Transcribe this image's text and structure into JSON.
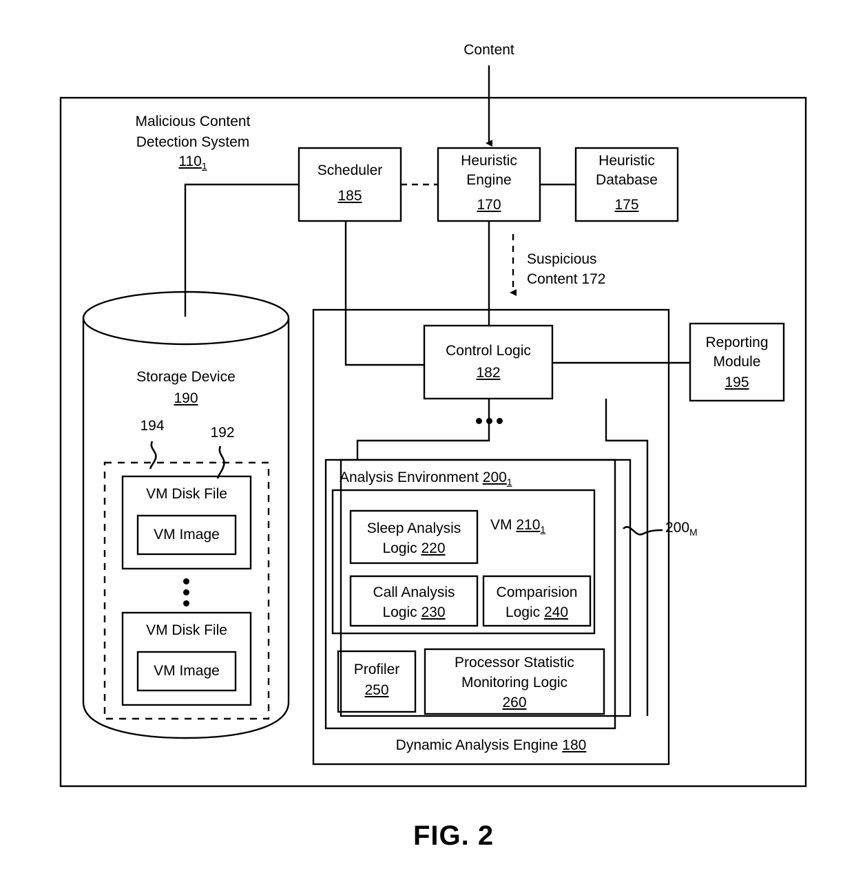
{
  "figure": {
    "caption": "FIG. 2",
    "input_label": "Content"
  },
  "system": {
    "title_line1": "Malicious Content",
    "title_line2": "Detection System",
    "ref": "110",
    "ref_sub": "1"
  },
  "blocks": {
    "scheduler": {
      "label": "Scheduler",
      "ref": "185"
    },
    "heuristic_engine": {
      "label_line1": "Heuristic",
      "label_line2": "Engine",
      "ref": "170"
    },
    "heuristic_database": {
      "label_line1": "Heuristic",
      "label_line2": "Database",
      "ref": "175"
    },
    "control_logic": {
      "label": "Control Logic",
      "ref": "182"
    },
    "reporting_module": {
      "label_line1": "Reporting",
      "label_line2": "Module",
      "ref": "195"
    },
    "storage_device": {
      "label": "Storage Device",
      "ref": "190"
    },
    "dynamic_analysis_engine": {
      "label": "Dynamic Analysis Engine",
      "ref": "180"
    },
    "analysis_environment": {
      "label": "Analysis Environment",
      "ref": "200",
      "ref_sub": "1"
    },
    "analysis_environment_last": {
      "ref": "200",
      "ref_sub": "M"
    },
    "vm": {
      "label": "VM",
      "ref": "210",
      "ref_sub": "1"
    },
    "sleep_analysis_logic": {
      "label_line1": "Sleep Analysis",
      "label_line2": "Logic",
      "ref": "220"
    },
    "call_analysis_logic": {
      "label_line1": "Call Analysis",
      "label_line2": "Logic",
      "ref": "230"
    },
    "comparison_logic": {
      "label_line1": "Comparision",
      "label_line2": "Logic",
      "ref": "240"
    },
    "profiler": {
      "label": "Profiler",
      "ref": "250"
    },
    "processor_statistic_monitoring_logic": {
      "label_line1": "Processor Statistic",
      "label_line2": "Monitoring Logic",
      "ref": "260"
    },
    "vm_disk_file_1": {
      "label": "VM Disk File"
    },
    "vm_image_1": {
      "label": "VM Image"
    },
    "vm_disk_file_n": {
      "label": "VM Disk File"
    },
    "vm_image_n": {
      "label": "VM Image"
    }
  },
  "callouts": {
    "vm_disk_file_group": "194",
    "vm_disk_file_item": "192"
  },
  "flows": {
    "suspicious_content_line1": "Suspicious",
    "suspicious_content_line2": "Content 172"
  },
  "style": {
    "stroke": "#000000",
    "background": "#ffffff"
  }
}
